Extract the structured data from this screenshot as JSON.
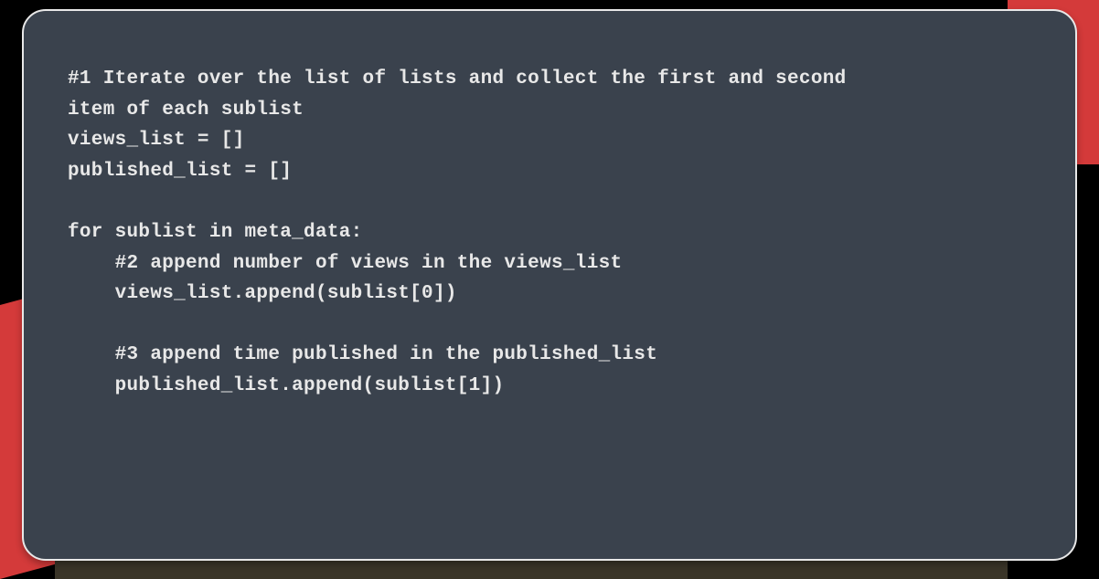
{
  "code": {
    "line1": "#1 Iterate over the list of lists and collect the first and second",
    "line2": "item of each sublist",
    "line3": "views_list = []",
    "line4": "published_list = []",
    "line5": "",
    "line6": "for sublist in meta_data:",
    "line7": "    #2 append number of views in the views_list",
    "line8": "    views_list.append(sublist[0])",
    "line9": "",
    "line10": "    #3 append time published in the published_list",
    "line11": "    published_list.append(sublist[1])"
  }
}
